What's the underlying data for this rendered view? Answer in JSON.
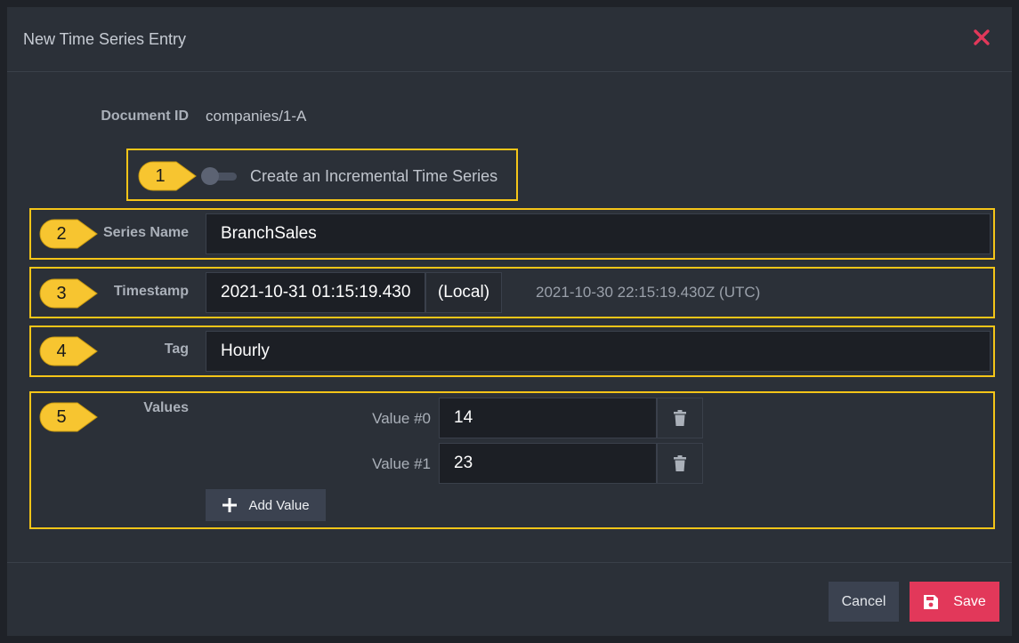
{
  "dialog": {
    "title": "New Time Series Entry"
  },
  "document_id": {
    "label": "Document ID",
    "value": "companies/1-A"
  },
  "incremental": {
    "label": "Create an Incremental Time Series",
    "enabled": false
  },
  "series_name": {
    "label": "Series Name",
    "value": "BranchSales"
  },
  "timestamp": {
    "label": "Timestamp",
    "value": "2021-10-31 01:15:19.430",
    "zone": "(Local)",
    "utc": "2021-10-30 22:15:19.430Z (UTC)"
  },
  "tag": {
    "label": "Tag",
    "value": "Hourly"
  },
  "values": {
    "label": "Values",
    "items": [
      {
        "label": "Value #0",
        "value": "14"
      },
      {
        "label": "Value #1",
        "value": "23"
      }
    ],
    "add_label": "Add Value"
  },
  "footer": {
    "cancel_label": "Cancel",
    "save_label": "Save"
  },
  "callouts": [
    "1",
    "2",
    "3",
    "4",
    "5"
  ],
  "colors": {
    "highlight": "#f5c518",
    "callout": "#f7c530",
    "save": "#e2385a",
    "close": "#e2385a"
  }
}
